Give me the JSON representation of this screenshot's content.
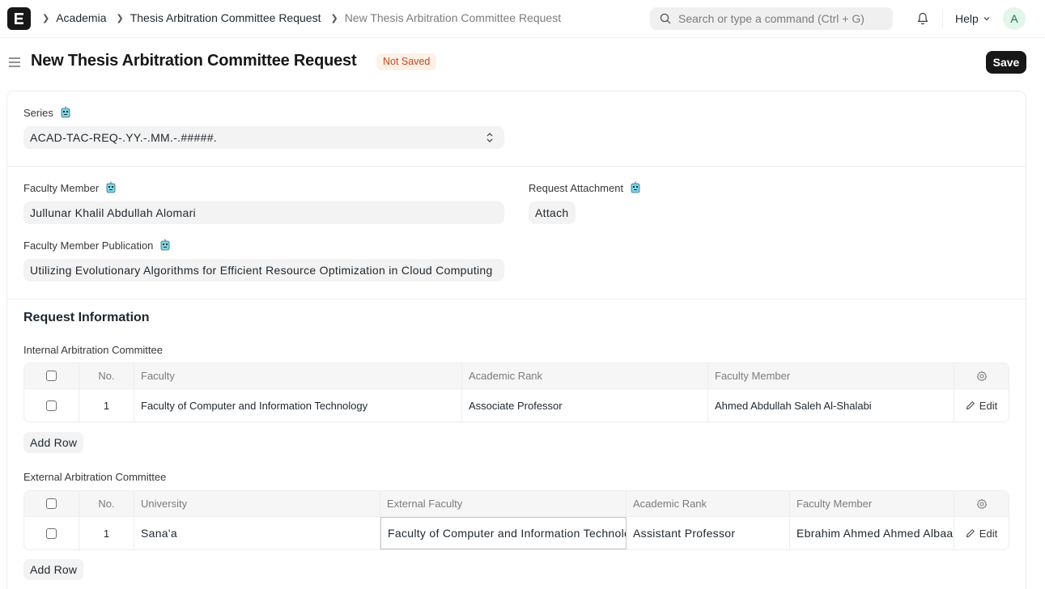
{
  "breadcrumbs": [
    "Academia",
    "Thesis Arbitration Committee Request",
    "New Thesis Arbitration Committee Request"
  ],
  "search": {
    "placeholder": "Search or type a command (Ctrl + G)"
  },
  "nav": {
    "help_label": "Help",
    "avatar_initial": "A"
  },
  "page": {
    "title": "New Thesis Arbitration Committee Request",
    "status": "Not Saved",
    "save_label": "Save"
  },
  "form": {
    "series": {
      "label": "Series",
      "value": "ACAD-TAC-REQ-.YY.-.MM.-.#####."
    },
    "faculty_member": {
      "label": "Faculty Member",
      "value": "Jullunar Khalil Abdullah Alomari"
    },
    "request_attachment": {
      "label": "Request Attachment",
      "button": "Attach"
    },
    "faculty_member_publication": {
      "label": "Faculty Member Publication",
      "value": "Utilizing Evolutionary Algorithms for Efficient Resource Optimization in Cloud Computing"
    },
    "section_title": "Request Information"
  },
  "internal": {
    "label": "Internal Arbitration Committee",
    "headers": [
      "No.",
      "Faculty",
      "Academic Rank",
      "Faculty Member"
    ],
    "rows": [
      {
        "no": "1",
        "faculty": "Faculty of Computer and Information Technology",
        "rank": "Associate Professor",
        "member": "Ahmed Abdullah Saleh Al-Shalabi",
        "edit": "Edit"
      }
    ],
    "add_row": "Add Row"
  },
  "external": {
    "label": "External Arbitration Committee",
    "headers": [
      "No.",
      "University",
      "External Faculty",
      "Academic Rank",
      "Faculty Member"
    ],
    "rows": [
      {
        "no": "1",
        "university": "Sana'a",
        "external_faculty": "Faculty of Computer and Information Technology",
        "rank": "Assistant Professor",
        "member": "Ebrahim Ahmed Ahmed Albaadani",
        "edit": "Edit"
      }
    ],
    "add_row": "Add Row"
  },
  "colors": {
    "accent": "#171717",
    "status_bg": "#fff1e7",
    "status_text": "#c4481a"
  },
  "icons": [
    "app-logo-icon",
    "chevron-right-icon",
    "search-icon",
    "bell-icon",
    "chevron-down-icon",
    "hamburger-icon",
    "robot-icon",
    "select-arrows-icon",
    "gear-icon",
    "pencil-icon"
  ]
}
